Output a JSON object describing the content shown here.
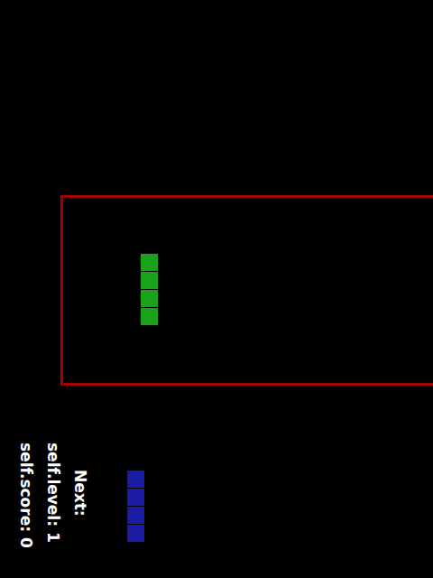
{
  "hud": {
    "score": "self.score: 0",
    "level": "self.level: 1",
    "next_label": "Next:"
  },
  "current_piece": {
    "color": "#1aa31a",
    "cells": [
      [
        4,
        3
      ],
      [
        4,
        4
      ],
      [
        4,
        5
      ],
      [
        4,
        6
      ]
    ]
  },
  "next_piece": {
    "color": "#1a1aa3",
    "cells": [
      [
        0,
        0
      ],
      [
        0,
        1
      ],
      [
        0,
        2
      ],
      [
        0,
        3
      ]
    ]
  }
}
